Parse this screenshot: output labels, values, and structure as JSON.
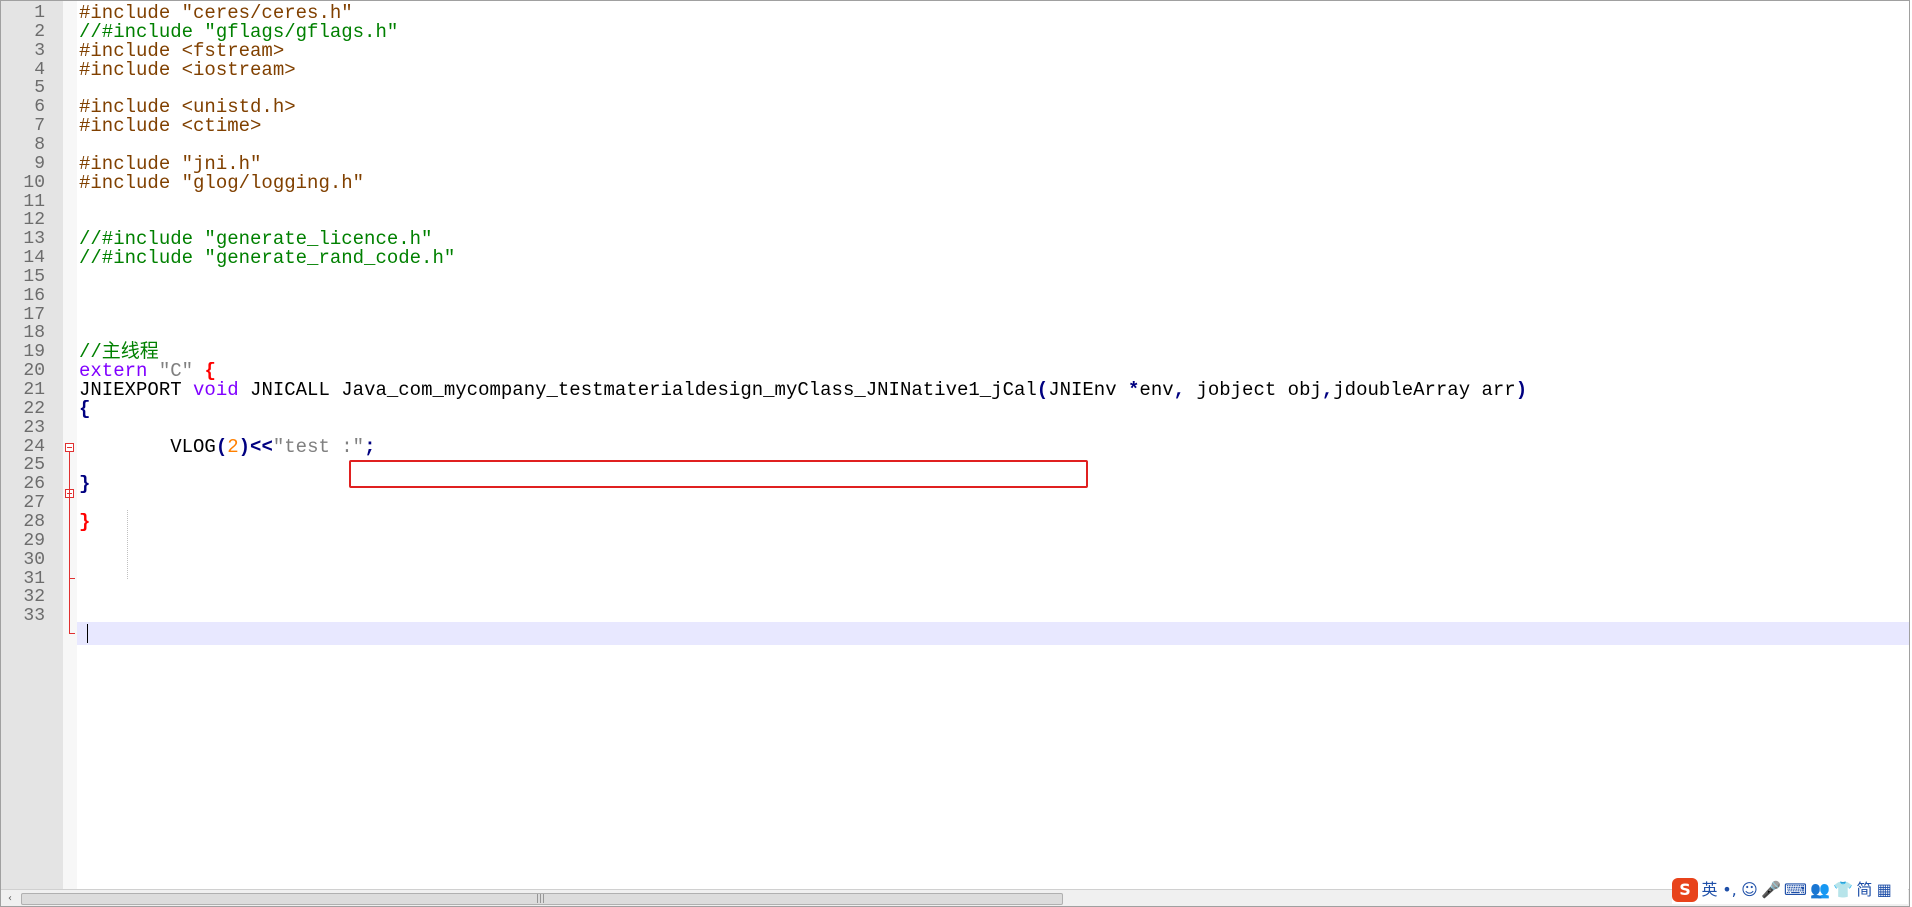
{
  "editor": {
    "lines": [
      {
        "n": "1",
        "segs": [
          {
            "t": "#include \"ceres/ceres.h\"",
            "c": "pre"
          }
        ]
      },
      {
        "n": "2",
        "segs": [
          {
            "t": "//#include \"gflags/gflags.h\"",
            "c": "cmt"
          }
        ]
      },
      {
        "n": "3",
        "segs": [
          {
            "t": "#include <fstream>",
            "c": "pre"
          }
        ]
      },
      {
        "n": "4",
        "segs": [
          {
            "t": "#include <iostream>",
            "c": "pre"
          }
        ]
      },
      {
        "n": "5",
        "segs": []
      },
      {
        "n": "6",
        "segs": [
          {
            "t": "#include <unistd.h>",
            "c": "pre"
          }
        ]
      },
      {
        "n": "7",
        "segs": [
          {
            "t": "#include <ctime>",
            "c": "pre"
          }
        ]
      },
      {
        "n": "8",
        "segs": []
      },
      {
        "n": "9",
        "segs": [
          {
            "t": "#include \"jni.h\"",
            "c": "pre"
          }
        ]
      },
      {
        "n": "10",
        "segs": [
          {
            "t": "#include \"glog/logging.h\"",
            "c": "pre"
          }
        ]
      },
      {
        "n": "11",
        "segs": []
      },
      {
        "n": "12",
        "segs": []
      },
      {
        "n": "13",
        "segs": [
          {
            "t": "//#include \"generate_licence.h\"",
            "c": "cmt"
          }
        ]
      },
      {
        "n": "14",
        "segs": [
          {
            "t": "//#include \"generate_rand_code.h\"",
            "c": "cmt"
          }
        ]
      },
      {
        "n": "15",
        "segs": []
      },
      {
        "n": "16",
        "segs": []
      },
      {
        "n": "17",
        "segs": []
      },
      {
        "n": "18",
        "segs": []
      },
      {
        "n": "19",
        "segs": [
          {
            "t": "//主线程",
            "c": "cmt"
          }
        ]
      },
      {
        "n": "20",
        "segs": [
          {
            "t": "extern",
            "c": "kw"
          },
          {
            "t": " ",
            "c": ""
          },
          {
            "t": "\"C\"",
            "c": "str"
          },
          {
            "t": " ",
            "c": ""
          },
          {
            "t": "{",
            "c": "brace-red"
          }
        ]
      },
      {
        "n": "21",
        "segs": [
          {
            "t": "JNIEXPORT ",
            "c": ""
          },
          {
            "t": "void",
            "c": "kw"
          },
          {
            "t": " JNICALL ",
            "c": ""
          },
          {
            "t": "Java_com_mycompany_testmaterialdesign_myClass_JNINative1_jCal",
            "c": ""
          },
          {
            "t": "(",
            "c": "op"
          },
          {
            "t": "JNIEnv ",
            "c": ""
          },
          {
            "t": "*",
            "c": "op"
          },
          {
            "t": "env",
            "c": ""
          },
          {
            "t": ",",
            "c": "op"
          },
          {
            "t": " jobject obj",
            "c": ""
          },
          {
            "t": ",",
            "c": "op"
          },
          {
            "t": "jdoubleArray arr",
            "c": ""
          },
          {
            "t": ")",
            "c": "op"
          }
        ]
      },
      {
        "n": "22",
        "segs": [
          {
            "t": "{",
            "c": "brace"
          }
        ]
      },
      {
        "n": "23",
        "segs": []
      },
      {
        "n": "24",
        "segs": [
          {
            "t": "        VLOG",
            "c": ""
          },
          {
            "t": "(",
            "c": "op"
          },
          {
            "t": "2",
            "c": "num"
          },
          {
            "t": ")<<",
            "c": "op"
          },
          {
            "t": "\"test :\"",
            "c": "str"
          },
          {
            "t": ";",
            "c": "op"
          }
        ]
      },
      {
        "n": "25",
        "segs": []
      },
      {
        "n": "26",
        "segs": [
          {
            "t": "}",
            "c": "brace"
          }
        ]
      },
      {
        "n": "27",
        "segs": []
      },
      {
        "n": "28",
        "segs": [
          {
            "t": "}",
            "c": "brace-red"
          }
        ]
      },
      {
        "n": "29",
        "segs": []
      },
      {
        "n": "30",
        "segs": []
      },
      {
        "n": "31",
        "segs": []
      },
      {
        "n": "32",
        "segs": []
      },
      {
        "n": "33",
        "segs": []
      }
    ],
    "current_line": "28",
    "highlighted_text": "Java_com_mycompany_testmaterialdesign_myClass_JNINative1_jCal"
  },
  "scrollbar": {
    "left_arrow": "‹",
    "grip": "|||"
  },
  "ime_toolbar": {
    "logo": "S",
    "items": [
      {
        "name": "ime-lang-toggle",
        "label": "英"
      },
      {
        "name": "ime-punct-icon",
        "label": "•,"
      },
      {
        "name": "ime-emoji-icon",
        "label": "☺"
      },
      {
        "name": "ime-voice-icon",
        "label": "🎤"
      },
      {
        "name": "ime-keyboard-icon",
        "label": "⌨"
      },
      {
        "name": "ime-user-icon",
        "label": "👥"
      },
      {
        "name": "ime-skin-icon",
        "label": "👕"
      },
      {
        "name": "ime-simplified-toggle",
        "label": "简"
      },
      {
        "name": "ime-grid-icon",
        "label": "▦"
      }
    ]
  }
}
